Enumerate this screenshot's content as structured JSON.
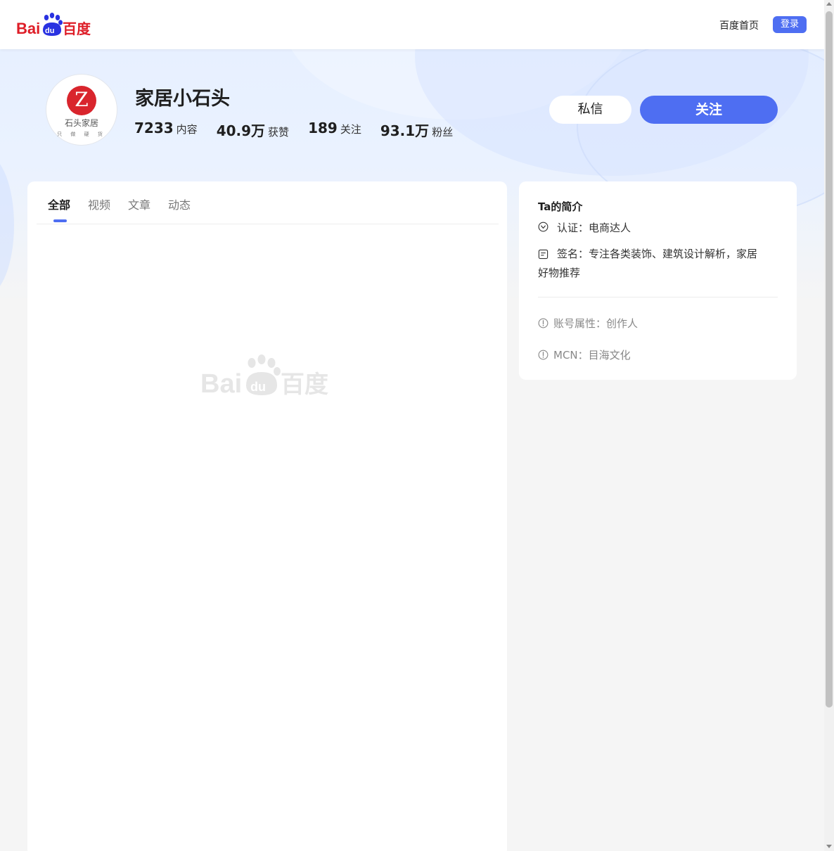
{
  "header": {
    "logo_text": "Bai du 百度",
    "home_link": "百度首页",
    "login_label": "登录"
  },
  "profile": {
    "avatar": {
      "logo_char": "Z",
      "brand": "石头家居",
      "slogan": "只 做 硬 货"
    },
    "name": "家居小石头",
    "stats": [
      {
        "num": "7233",
        "label": "内容"
      },
      {
        "num": "40.9万",
        "label": "获赞"
      },
      {
        "num": "189",
        "label": "关注"
      },
      {
        "num": "93.1万",
        "label": "粉丝"
      }
    ],
    "message_label": "私信",
    "follow_label": "关注"
  },
  "tabs": [
    {
      "label": "全部",
      "active": true
    },
    {
      "label": "视频",
      "active": false
    },
    {
      "label": "文章",
      "active": false
    },
    {
      "label": "动态",
      "active": false
    }
  ],
  "intro": {
    "title": "Ta的简介",
    "certification": "认证：电商达人",
    "signature_line1": "签名：专注各类装饰、建筑设计解析，家居",
    "signature_line2": "好物推荐",
    "account_type": "账号属性：创作人",
    "mcn": "MCN：目海文化"
  },
  "colors": {
    "accent": "#4e6ef2",
    "baidu_red": "#de1d27",
    "baidu_blue": "#2932e1",
    "avatar_red": "#d9252d"
  }
}
